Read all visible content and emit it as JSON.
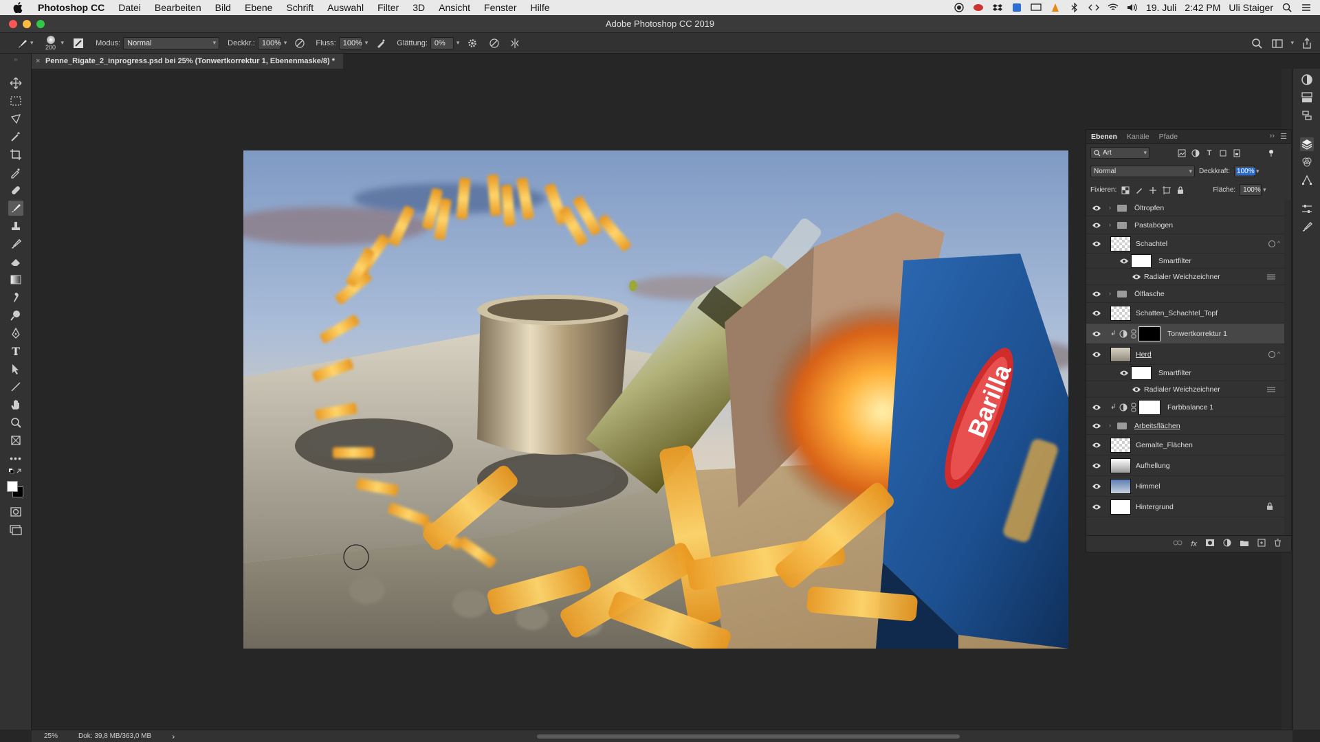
{
  "menubar": {
    "app_name": "Photoshop CC",
    "items": [
      "Datei",
      "Bearbeiten",
      "Bild",
      "Ebene",
      "Schrift",
      "Auswahl",
      "Filter",
      "3D",
      "Ansicht",
      "Fenster",
      "Hilfe"
    ],
    "date": "19. Juli",
    "time": "2:42 PM",
    "user": "Uli Staiger"
  },
  "window": {
    "title": "Adobe Photoshop CC 2019"
  },
  "options_bar": {
    "brush_size": "200",
    "mode_label": "Modus:",
    "mode_value": "Normal",
    "opacity_label": "Deckkr.:",
    "opacity_value": "100%",
    "flow_label": "Fluss:",
    "flow_value": "100%",
    "smoothing_label": "Glättung:",
    "smoothing_value": "0%"
  },
  "document": {
    "tab_title": "Penne_Rigate_2_inprogress.psd bei 25% (Tonwertkorrektur 1, Ebenenmaske/8) *",
    "close_symbol": "×"
  },
  "status": {
    "zoom": "25%",
    "doc_size": "Dok: 39,8 MB/363,0 MB",
    "arrow": "›"
  },
  "layers_panel": {
    "tabs": [
      "Ebenen",
      "Kanäle",
      "Pfade"
    ],
    "filter_kind": "Art",
    "blend_mode": "Normal",
    "opacity_label": "Deckkraft:",
    "opacity_value": "100%",
    "lock_label": "Fixieren:",
    "fill_label": "Fläche:",
    "fill_value": "100%",
    "layers": [
      {
        "name": "Öltropfen",
        "kind": "group",
        "underlined": false
      },
      {
        "name": "Pastabogen",
        "kind": "group",
        "underlined": false
      },
      {
        "name": "Schachtel",
        "kind": "smart",
        "underlined": false
      },
      {
        "name": "Smartfilter",
        "kind": "smartfilter",
        "underlined": false
      },
      {
        "name": "Radialer Weichzeichner",
        "kind": "filter",
        "underlined": false
      },
      {
        "name": "Ölflasche",
        "kind": "group",
        "underlined": false
      },
      {
        "name": "Schatten_Schachtel_Topf",
        "kind": "pixel",
        "underlined": false
      },
      {
        "name": "Tonwertkorrektur 1",
        "kind": "adjustment",
        "underlined": false,
        "selected": true
      },
      {
        "name": "Herd",
        "kind": "smart",
        "underlined": true
      },
      {
        "name": "Smartfilter",
        "kind": "smartfilter",
        "underlined": false
      },
      {
        "name": "Radialer Weichzeichner",
        "kind": "filter",
        "underlined": false
      },
      {
        "name": "Farbbalance 1",
        "kind": "adjustment",
        "underlined": false
      },
      {
        "name": "Arbeitsflächen",
        "kind": "group",
        "underlined": true
      },
      {
        "name": "Gemalte_Flächen",
        "kind": "pixel",
        "underlined": false
      },
      {
        "name": "Aufhellung",
        "kind": "pixel",
        "underlined": false
      },
      {
        "name": "Himmel",
        "kind": "pixel",
        "underlined": false
      },
      {
        "name": "Hintergrund",
        "kind": "background",
        "underlined": false
      }
    ]
  },
  "canvas": {
    "box_brand": "Barilla"
  },
  "colors": {
    "ui_dark": "#262626",
    "panel": "#323232",
    "selected_row": "#474747",
    "accent_blue": "#1f5fa8",
    "box_blue": "#1c4f8f",
    "barilla_red": "#d02c2c"
  },
  "icons": {
    "tools": [
      "move-icon",
      "marquee-icon",
      "lasso-icon",
      "magic-wand-icon",
      "crop-icon",
      "eyedropper-icon",
      "healing-icon",
      "brush-icon",
      "stamp-icon",
      "history-brush-icon",
      "eraser-icon",
      "gradient-icon",
      "smudge-icon",
      "dodge-icon",
      "pen-icon",
      "type-icon",
      "path-select-icon",
      "line-icon",
      "hand-icon",
      "zoom-icon",
      "artboard-icon",
      "more-tools-icon"
    ]
  }
}
